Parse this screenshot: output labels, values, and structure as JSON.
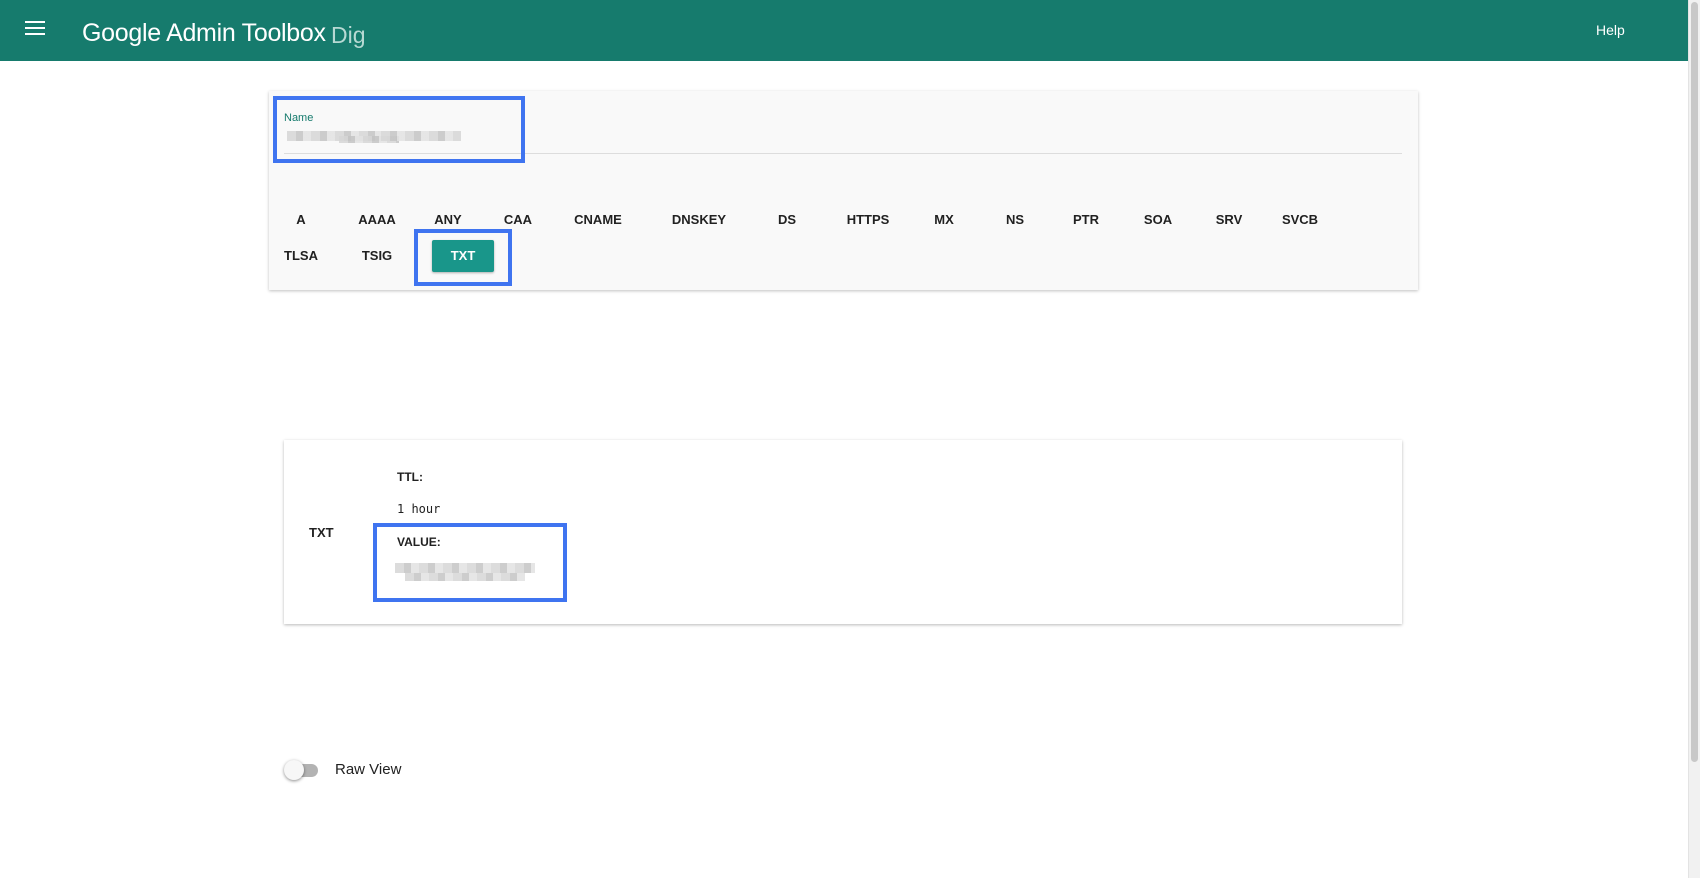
{
  "header": {
    "menu_icon": "hamburger-menu-icon",
    "title": "Google Admin Toolbox",
    "subtitle": "Dig",
    "help_label": "Help",
    "bar_color": "#167b6d"
  },
  "query": {
    "name_label": "Name",
    "name_value": "",
    "record_types": [
      "A",
      "AAAA",
      "ANY",
      "CAA",
      "CNAME",
      "DNSKEY",
      "DS",
      "HTTPS",
      "MX",
      "NS",
      "PTR",
      "SOA",
      "SRV",
      "SVCB",
      "TLSA",
      "TSIG",
      "TXT"
    ],
    "selected_type": "TXT",
    "accent_color": "#19968a"
  },
  "result": {
    "type": "TXT",
    "ttl_label": "TTL:",
    "ttl_value": "1 hour",
    "value_label": "VALUE:",
    "value": ""
  },
  "raw_view": {
    "label": "Raw View",
    "enabled": false
  },
  "highlight_color": "#3f74f0"
}
